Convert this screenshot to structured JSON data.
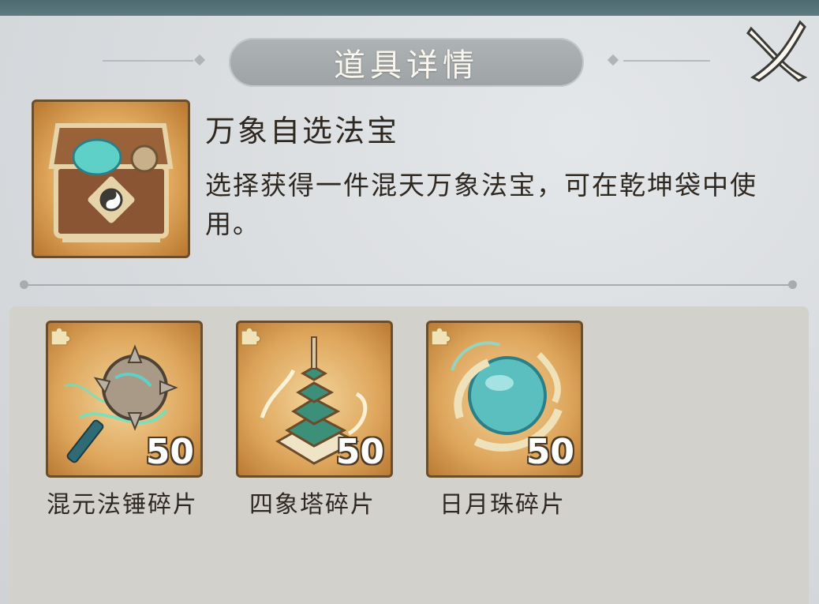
{
  "dialog": {
    "title": "道具详情",
    "close_icon": "close-x-icon"
  },
  "item": {
    "icon": "treasure-chest-icon",
    "name": "万象自选法宝",
    "description": "选择获得一件混天万象法宝，可在乾坤袋中使用。"
  },
  "choices": [
    {
      "icon": "spiked-mace-icon",
      "badge_icon": "puzzle-piece-icon",
      "quantity": "50",
      "label": "混元法锤碎片"
    },
    {
      "icon": "pagoda-tower-icon",
      "badge_icon": "puzzle-piece-icon",
      "quantity": "50",
      "label": "四象塔碎片"
    },
    {
      "icon": "sun-moon-orb-icon",
      "badge_icon": "puzzle-piece-icon",
      "quantity": "50",
      "label": "日月珠碎片"
    }
  ],
  "colors": {
    "frame_border": "#6a4d2a",
    "icon_gold": "#dea65c",
    "title_banner": "#a7acaf",
    "text": "#2f2820"
  }
}
